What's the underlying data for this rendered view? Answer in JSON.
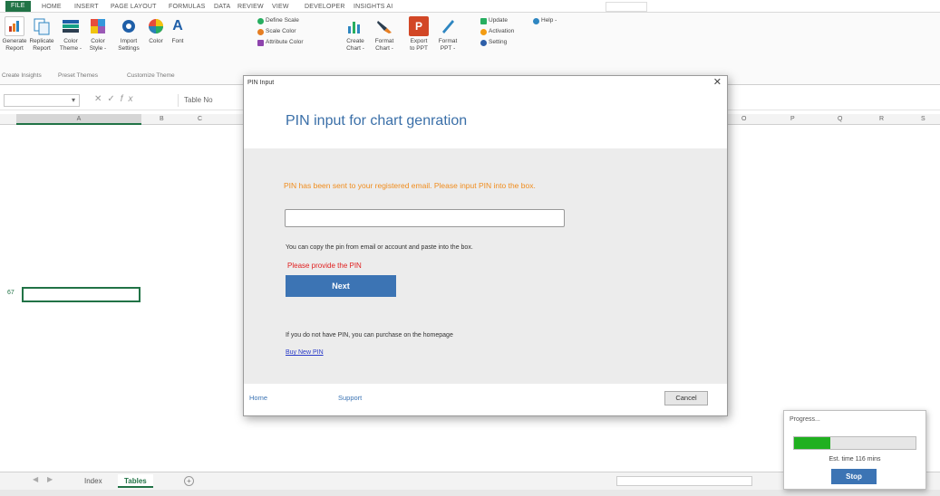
{
  "ribbon_tabs": [
    {
      "label": "FILE"
    },
    {
      "label": "HOME"
    },
    {
      "label": "INSERT"
    },
    {
      "label": "PAGE LAYOUT"
    },
    {
      "label": "FORMULAS"
    },
    {
      "label": "DATA"
    },
    {
      "label": "REVIEW"
    },
    {
      "label": "VIEW"
    },
    {
      "label": "DEVELOPER"
    },
    {
      "label": "INSIGHTS AI"
    }
  ],
  "ribbon": {
    "buttons": [
      {
        "label": "Generate\nReport",
        "icon": "chart-report-icon"
      },
      {
        "label": "Replicate\nReport",
        "icon": "copy-report-icon"
      },
      {
        "label": "Color\nTheme -",
        "icon": "color-theme-icon"
      },
      {
        "label": "Color\nStyle -",
        "icon": "color-style-icon"
      },
      {
        "label": "Import\nSettings",
        "icon": "import-icon"
      },
      {
        "label": "Color",
        "icon": "color-wheel-icon"
      },
      {
        "label": "Font",
        "icon": "font-icon"
      },
      {
        "label": "Create\nChart -",
        "icon": "bar-chart-icon"
      },
      {
        "label": "Format\nChart -",
        "icon": "format-brush-icon"
      },
      {
        "label": "Export\nto PPT",
        "icon": "powerpoint-icon"
      },
      {
        "label": "Format\nPPT -",
        "icon": "pen-icon"
      }
    ],
    "small_buttons": {
      "define_scale": "Define Scale",
      "scale_color": "Scale Color",
      "attribute_color": "Attribute Color",
      "update": "Update",
      "activation": "Activation",
      "setting": "Setting",
      "help": "Help -"
    },
    "groups": {
      "create_insights": "Create Insights",
      "preset_themes": "Preset Themes",
      "customize_theme": "Customize Theme"
    }
  },
  "formula_bar": {
    "formula": "Table No"
  },
  "columns": [
    "A",
    "B",
    "C",
    "O",
    "P",
    "Q",
    "R",
    "S"
  ],
  "row_label": "67",
  "dialog": {
    "window_title": "PIN Input",
    "heading": "PIN input for chart genration",
    "sent_message": "PIN has been sent to your registered email. Please input PIN into the box.",
    "pin_value": "",
    "hint": "You can copy the pin from email or account and paste into the box.",
    "error": "Please provide the PIN",
    "next_label": "Next",
    "no_pin_text": "If you do not have PIN, you can purchase on the homepage",
    "buy_link": "Buy New PIN",
    "home_link": "Home",
    "support_link": "Support",
    "cancel_label": "Cancel"
  },
  "progress": {
    "title": "Progress...",
    "percent": 0.3,
    "eta": "Est. time 116 mins",
    "stop_label": "Stop",
    "bar_color": "#20b020"
  },
  "sheets": {
    "tabs": [
      "Index",
      "Tables"
    ],
    "active": "Tables",
    "add": "+"
  }
}
